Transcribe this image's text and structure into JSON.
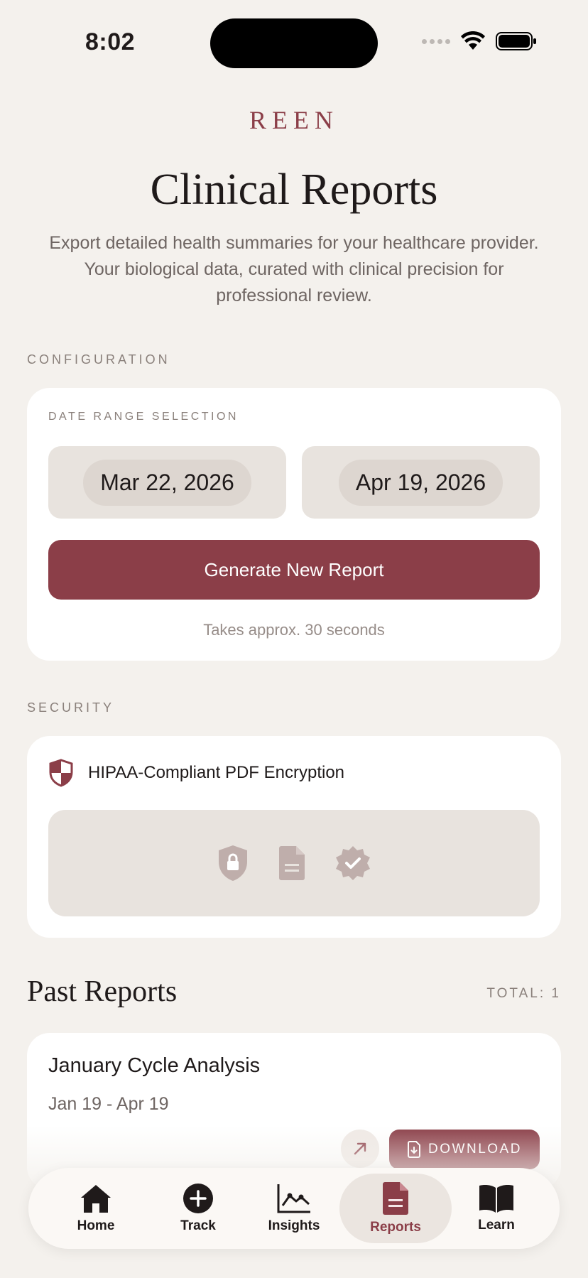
{
  "status": {
    "time": "8:02"
  },
  "brand": "REEN",
  "header": {
    "title": "Clinical Reports",
    "description": "Export detailed health summaries for your healthcare provider. Your biological data, curated with clinical precision for professional review."
  },
  "configuration": {
    "section_label": "CONFIGURATION",
    "date_range_label": "DATE RANGE SELECTION",
    "start_date": "Mar 22, 2026",
    "end_date": "Apr 19, 2026",
    "generate_label": "Generate New Report",
    "hint": "Takes approx. 30 seconds"
  },
  "security": {
    "section_label": "SECURITY",
    "title": "HIPAA-Compliant PDF Encryption",
    "icons": [
      "shield-lock-icon",
      "document-icon",
      "verified-badge-icon"
    ]
  },
  "past_reports": {
    "title": "Past Reports",
    "total": "TOTAL: 1",
    "items": [
      {
        "title": "January Cycle Analysis",
        "range": "Jan 19 - Apr 19",
        "download_label": "DOWNLOAD"
      }
    ]
  },
  "tabs": [
    {
      "label": "Home",
      "icon": "home-icon"
    },
    {
      "label": "Track",
      "icon": "plus-circle-icon"
    },
    {
      "label": "Insights",
      "icon": "chart-icon"
    },
    {
      "label": "Reports",
      "icon": "report-icon",
      "active": true
    },
    {
      "label": "Learn",
      "icon": "book-icon"
    }
  ],
  "colors": {
    "accent": "#8b3e48",
    "background": "#f4f1ed",
    "card": "#ffffff",
    "muted_panel": "#e8e3de"
  }
}
